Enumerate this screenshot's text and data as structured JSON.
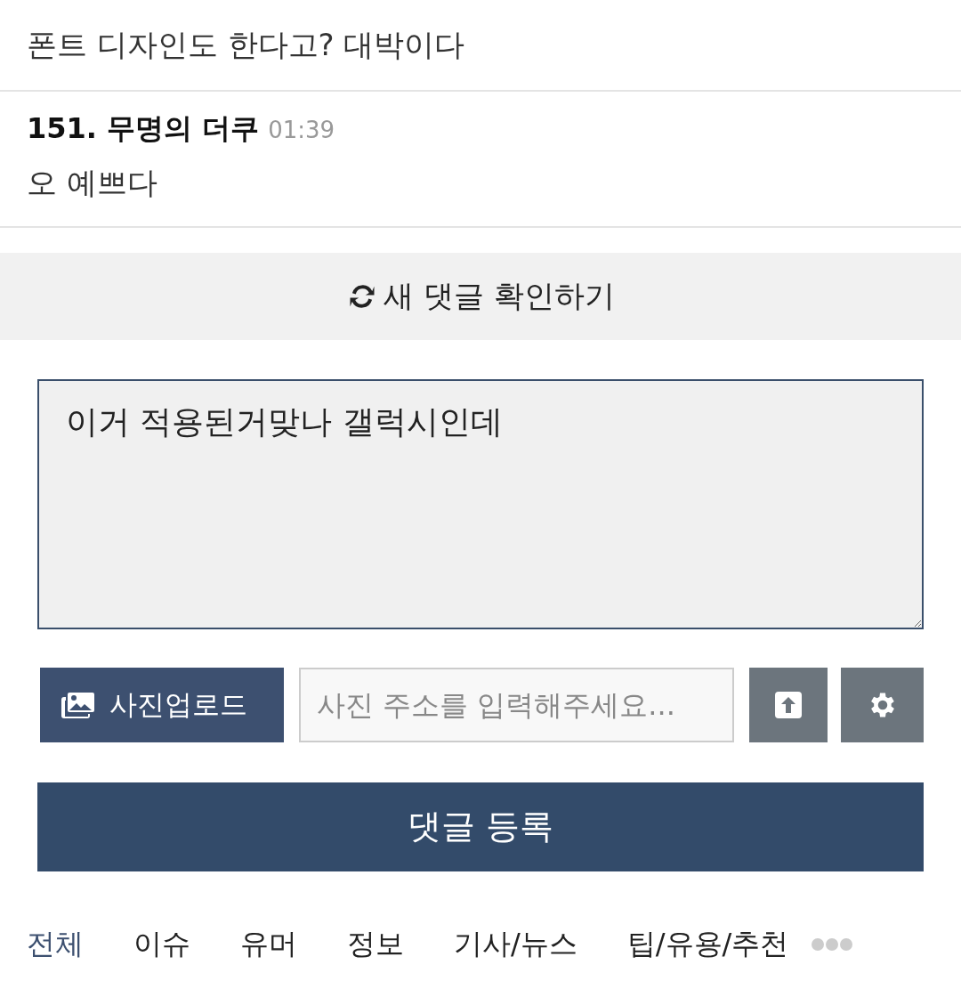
{
  "comments": [
    {
      "text": "폰트 디자인도 한다고? 대박이다"
    },
    {
      "author": "151. 무명의 더쿠",
      "time": "01:39",
      "text": "오 예쁘다"
    }
  ],
  "refresh": {
    "label": "새 댓글 확인하기"
  },
  "editor": {
    "value": "이거 적용된거맞나 갤럭시인데"
  },
  "photo": {
    "upload_label": "사진업로드",
    "url_placeholder": "사진 주소를 입력해주세요..."
  },
  "submit": {
    "label": "댓글 등록"
  },
  "tabs": [
    {
      "label": "전체",
      "selected": true
    },
    {
      "label": "이슈",
      "selected": false
    },
    {
      "label": "유머",
      "selected": false
    },
    {
      "label": "정보",
      "selected": false
    },
    {
      "label": "기사/뉴스",
      "selected": false
    },
    {
      "label": "팁/유용/추천",
      "selected": false
    }
  ]
}
